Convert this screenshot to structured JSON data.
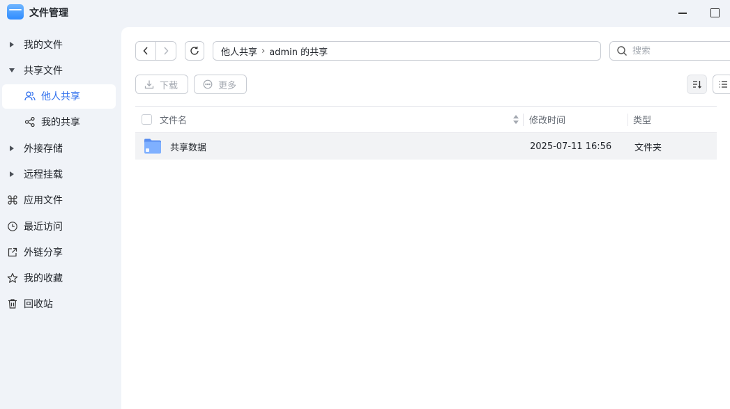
{
  "app": {
    "title": "文件管理"
  },
  "sidebar": {
    "items": [
      {
        "label": "我的文件"
      },
      {
        "label": "共享文件"
      },
      {
        "label": "他人共享"
      },
      {
        "label": "我的共享"
      },
      {
        "label": "外接存储"
      },
      {
        "label": "远程挂载"
      },
      {
        "label": "应用文件"
      },
      {
        "label": "最近访问"
      },
      {
        "label": "外链分享"
      },
      {
        "label": "我的收藏"
      },
      {
        "label": "回收站"
      }
    ]
  },
  "toolbar": {
    "path": [
      "他人共享",
      "admin 的共享"
    ],
    "search_placeholder": "搜索",
    "download_label": "下载",
    "more_label": "更多"
  },
  "table": {
    "headers": {
      "name": "文件名",
      "modified": "修改时间",
      "type": "类型"
    },
    "rows": [
      {
        "name": "共享数据",
        "modified": "2025-07-11 16:56",
        "type": "文件夹"
      }
    ]
  },
  "colors": {
    "accent": "#2f6fed",
    "folder": "#6fa8ff"
  }
}
